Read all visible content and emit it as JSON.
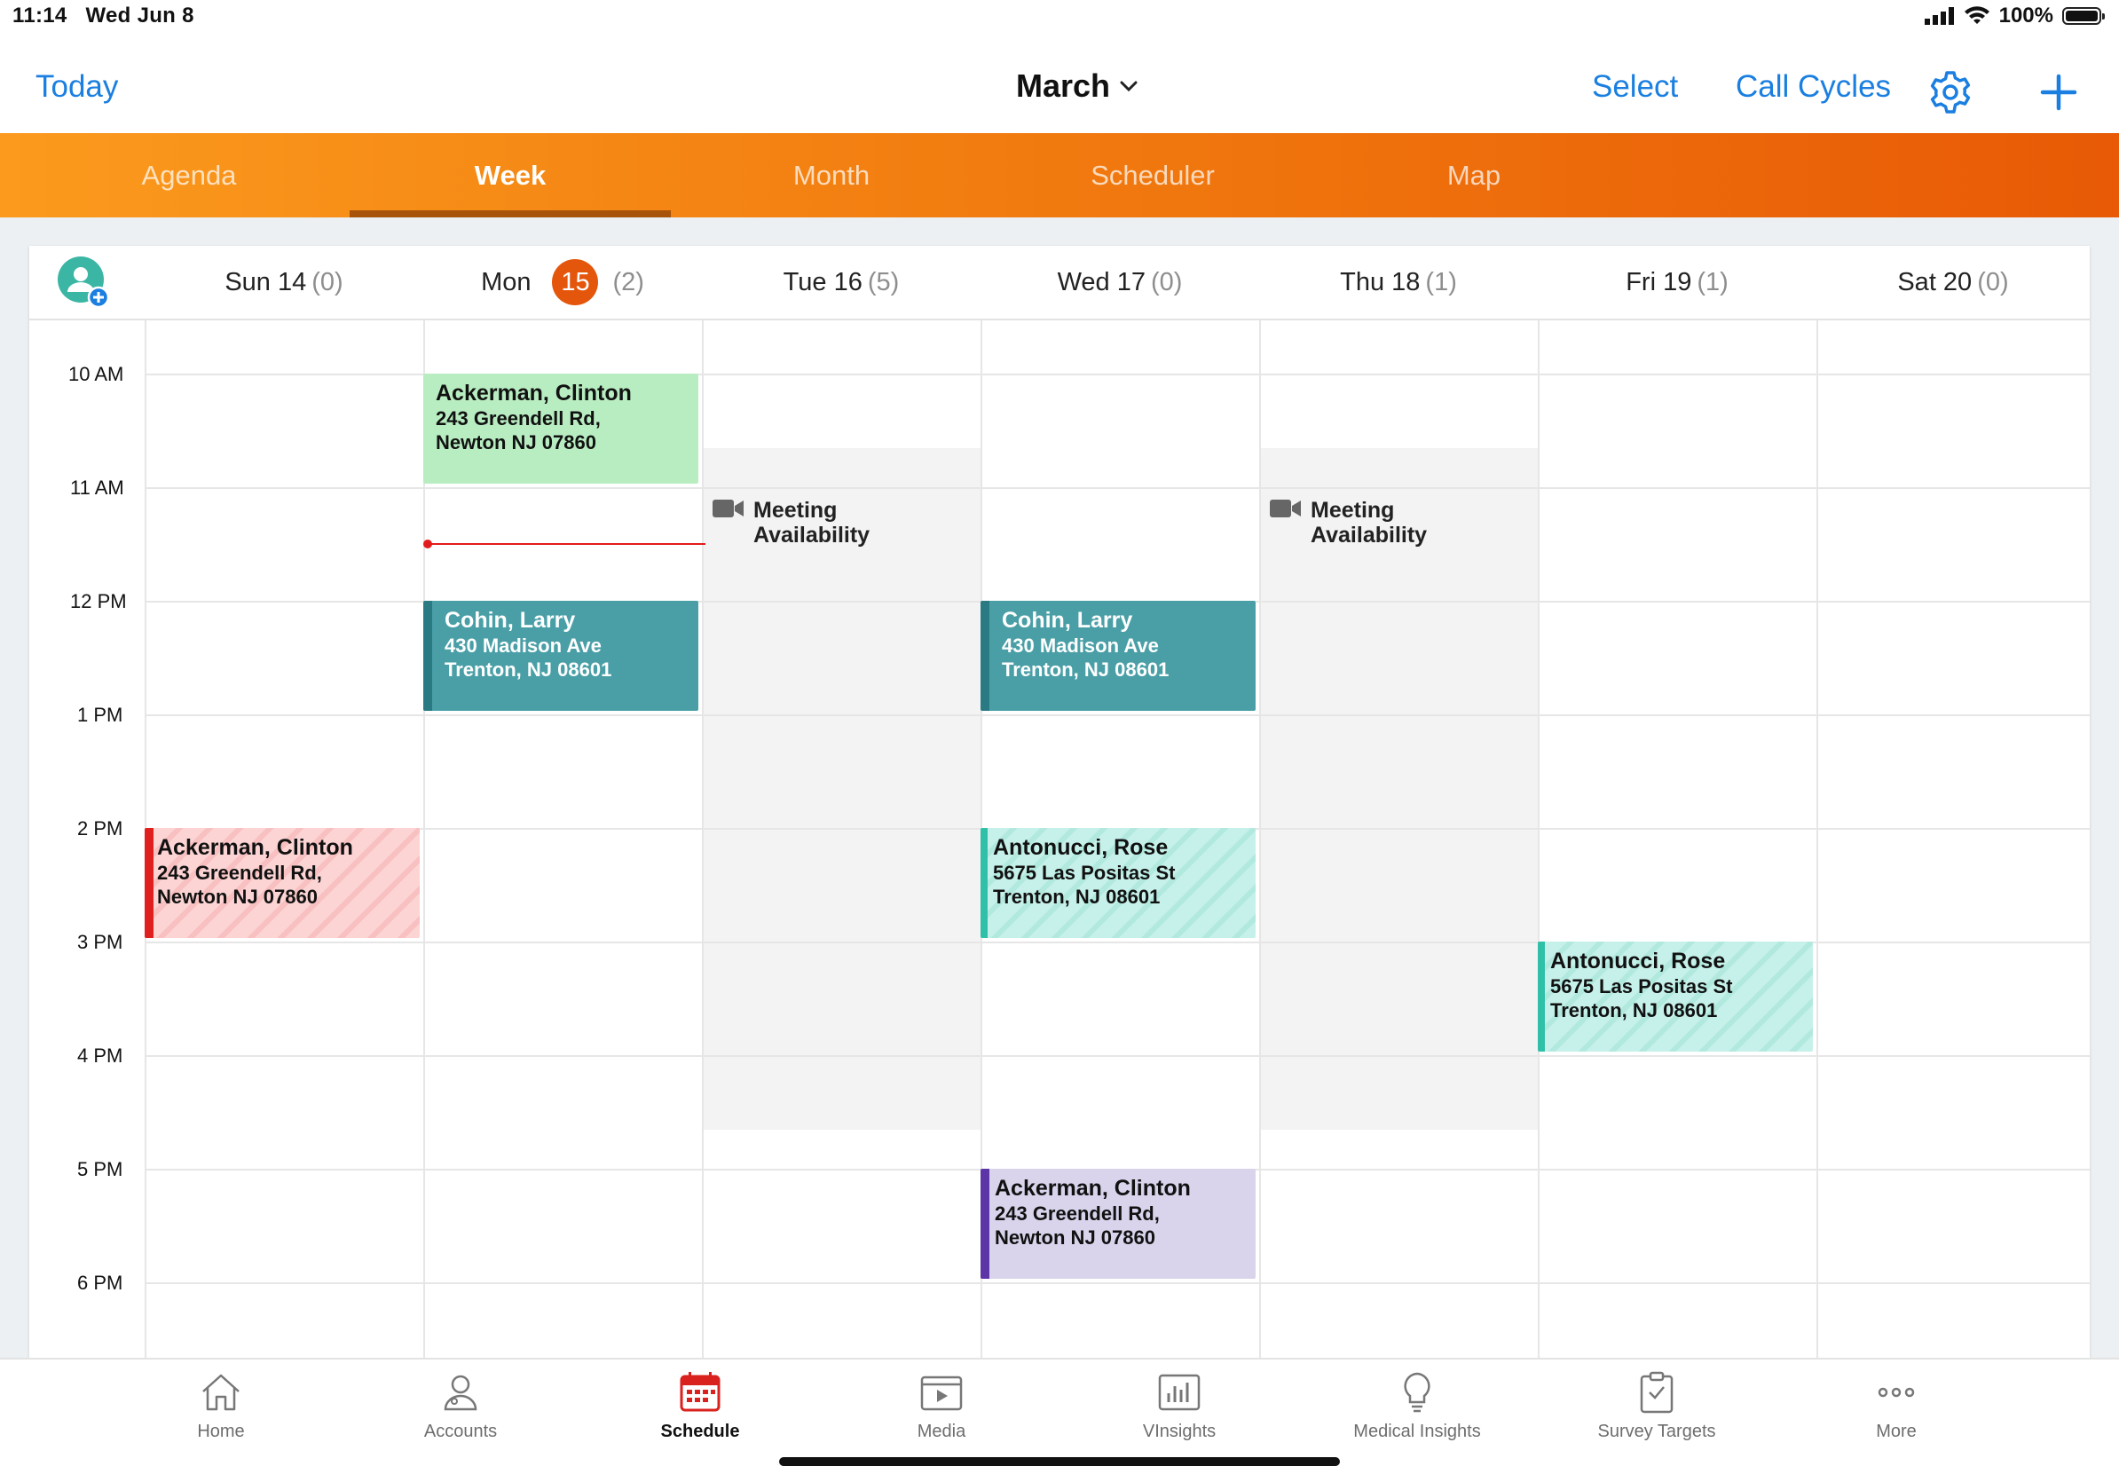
{
  "status": {
    "time": "11:14",
    "date": "Wed Jun 8",
    "battery": "100%"
  },
  "nav": {
    "today": "Today",
    "title": "March",
    "select": "Select",
    "call_cycles": "Call Cycles",
    "gear_icon": "gear-icon",
    "plus_icon": "plus-icon"
  },
  "tabs": [
    {
      "label": "Agenda",
      "active": false
    },
    {
      "label": "Week",
      "active": true
    },
    {
      "label": "Month",
      "active": false
    },
    {
      "label": "Scheduler",
      "active": false
    },
    {
      "label": "Map",
      "active": false
    }
  ],
  "days": [
    {
      "label": "Sun 14",
      "count": "(0)"
    },
    {
      "label": "Mon",
      "num": "15",
      "count": "(2)",
      "today": true
    },
    {
      "label": "Tue 16",
      "count": "(5)"
    },
    {
      "label": "Wed 17",
      "count": "(0)"
    },
    {
      "label": "Thu 18",
      "count": "(1)"
    },
    {
      "label": "Fri 19",
      "count": "(1)"
    },
    {
      "label": "Sat 20",
      "count": "(0)"
    }
  ],
  "times": [
    "10 AM",
    "11 AM",
    "12 PM",
    "1 PM",
    "2 PM",
    "3 PM",
    "4 PM",
    "5 PM",
    "6 PM"
  ],
  "meetings": [
    {
      "line1": "Meeting",
      "line2": "Availability"
    },
    {
      "line1": "Meeting",
      "line2": "Availability"
    }
  ],
  "events": [
    {
      "name": "Ackerman, Clinton",
      "line1": "243 Greendell Rd,",
      "line2": "Newton NJ 07860",
      "style": "green"
    },
    {
      "name": "Cohin, Larry",
      "line1": "430 Madison Ave",
      "line2": "Trenton, NJ 08601",
      "style": "teal"
    },
    {
      "name": "Cohin, Larry",
      "line1": "430 Madison Ave",
      "line2": "Trenton, NJ 08601",
      "style": "teal"
    },
    {
      "name": "Ackerman, Clinton",
      "line1": "243 Greendell Rd,",
      "line2": "Newton NJ 07860",
      "style": "red"
    },
    {
      "name": "Antonucci, Rose",
      "line1": "5675 Las Positas St",
      "line2": "Trenton, NJ 08601",
      "style": "mint"
    },
    {
      "name": "Antonucci, Rose",
      "line1": "5675 Las Positas St",
      "line2": "Trenton, NJ 08601",
      "style": "mint"
    },
    {
      "name": "Ackerman, Clinton",
      "line1": "243 Greendell Rd,",
      "line2": "Newton NJ 07860",
      "style": "purple"
    }
  ],
  "bottom_tabs": [
    {
      "label": "Home",
      "icon": "home-icon"
    },
    {
      "label": "Accounts",
      "icon": "accounts-icon"
    },
    {
      "label": "Schedule",
      "icon": "calendar-icon",
      "active": true
    },
    {
      "label": "Media",
      "icon": "media-icon"
    },
    {
      "label": "VInsights",
      "icon": "chart-icon"
    },
    {
      "label": "Medical Insights",
      "icon": "lightbulb-icon"
    },
    {
      "label": "Survey Targets",
      "icon": "clipboard-icon"
    },
    {
      "label": "More",
      "icon": "more-icon"
    }
  ],
  "colors": {
    "accent": "#1a7fe0",
    "tab_orange": "#f27d10",
    "today": "#e4560c",
    "now_line": "#e31b1b"
  }
}
